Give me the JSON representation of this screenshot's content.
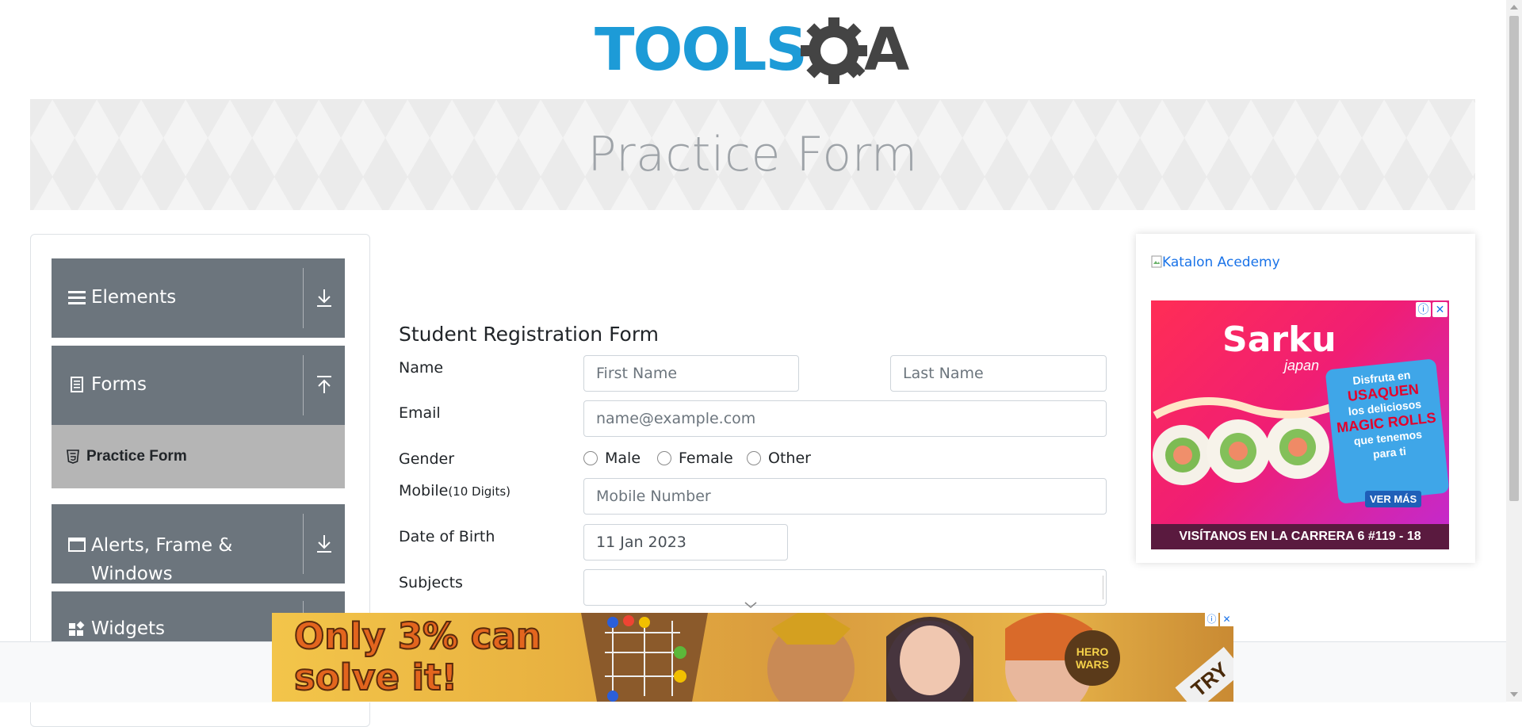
{
  "header": {
    "logo_text": "TOOLSQA"
  },
  "banner": {
    "title": "Practice Form"
  },
  "sidebar": {
    "groups": [
      {
        "label": "Elements",
        "icon": "hamburger-icon",
        "arrow": "download-arrow-icon"
      },
      {
        "label": "Forms",
        "icon": "document-icon",
        "arrow": "upload-arrow-icon"
      },
      {
        "label": "Alerts, Frame &",
        "label2": "Windows",
        "icon": "window-icon",
        "arrow": "download-arrow-icon"
      },
      {
        "label": "Widgets",
        "icon": "widgets-icon"
      }
    ],
    "active_item": {
      "label": "Practice Form",
      "icon": "html5-icon"
    }
  },
  "form": {
    "title": "Student Registration Form",
    "name_label": "Name",
    "first_name_placeholder": "First Name",
    "last_name_placeholder": "Last Name",
    "email_label": "Email",
    "email_placeholder": "name@example.com",
    "gender_label": "Gender",
    "gender_options": [
      "Male",
      "Female",
      "Other"
    ],
    "mobile_label": "Mobile",
    "mobile_hint": "(10 Digits)",
    "mobile_placeholder": "Mobile Number",
    "dob_label": "Date of Birth",
    "dob_value": "11 Jan 2023",
    "subjects_label": "Subjects",
    "subjects_value": ""
  },
  "right_ad": {
    "link_text": "Katalon Acedemy",
    "brand": "Sarku",
    "brand_sub": "japan",
    "bubble_lines": [
      "Disfruta en",
      "USAQUEN",
      "los deliciosos",
      "MAGIC ROLLS",
      "que tenemos",
      "para ti"
    ],
    "cta": "VER MÁS",
    "footer": "VISÍTANOS EN LA CARRERA 6 #119 - 18"
  },
  "bottom_ad": {
    "headline_1": "Only 3% can",
    "headline_2": "solve it!",
    "brand": "HERO WARS",
    "cta": "TRY"
  }
}
